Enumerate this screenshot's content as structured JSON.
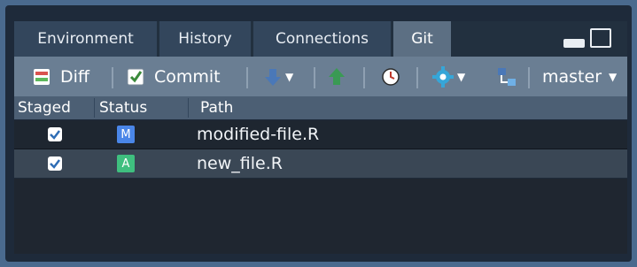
{
  "tabs": [
    {
      "label": "Environment",
      "active": false
    },
    {
      "label": "History",
      "active": false
    },
    {
      "label": "Connections",
      "active": false
    },
    {
      "label": "Git",
      "active": true
    }
  ],
  "toolbar": {
    "diff_label": "Diff",
    "commit_label": "Commit",
    "branch_label": "master",
    "icons": [
      "diff-icon",
      "commit-icon",
      "pull-icon",
      "push-icon",
      "history-icon",
      "gear-icon",
      "branch-icon"
    ]
  },
  "table": {
    "headers": [
      "Staged",
      "Status",
      "Path"
    ],
    "rows": [
      {
        "staged": true,
        "status": "M",
        "path": "modified-file.R",
        "status_color": "#4a86e8"
      },
      {
        "staged": true,
        "status": "A",
        "path": "new_file.R",
        "status_color": "#3fbf7f"
      }
    ]
  },
  "colors": {
    "accent_checkbox": "#2f6db5",
    "pull_arrow": "#4a78b8",
    "push_arrow": "#3a9a54",
    "gear": "#36a6d8"
  }
}
